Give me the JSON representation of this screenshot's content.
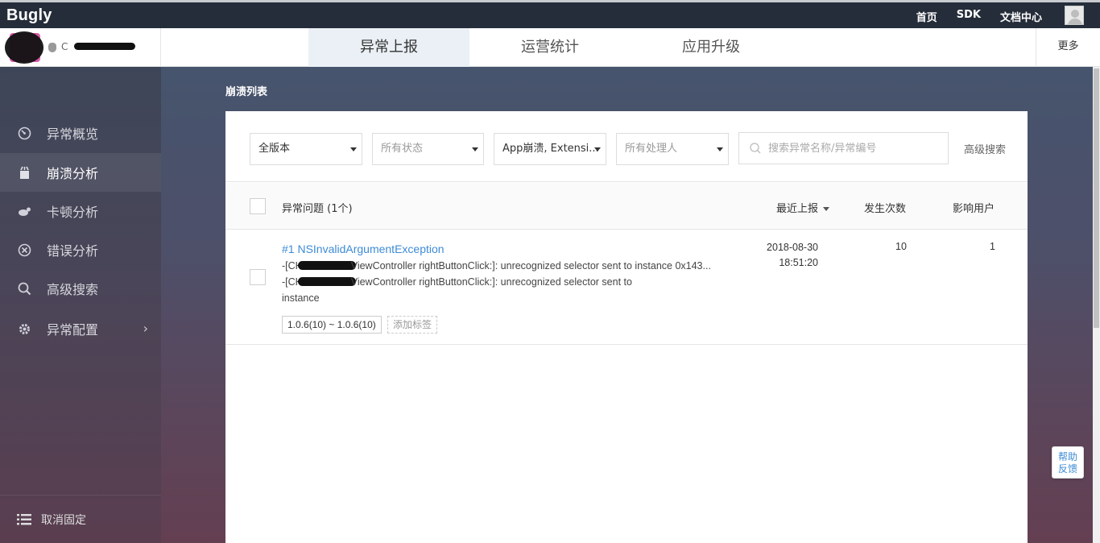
{
  "topbar": {
    "logo": "Bugly",
    "links": [
      "首页",
      "SDK",
      "文档中心"
    ]
  },
  "navbar": {
    "app_name": "C",
    "tabs": [
      "异常上报",
      "运营统计",
      "应用升级"
    ],
    "active_tab": 0,
    "more": "更多"
  },
  "sidebar": {
    "items": [
      {
        "label": "异常概览",
        "icon": "dashboard-icon"
      },
      {
        "label": "崩溃分析",
        "icon": "crash-icon",
        "active": true
      },
      {
        "label": "卡顿分析",
        "icon": "lag-icon"
      },
      {
        "label": "错误分析",
        "icon": "error-icon"
      },
      {
        "label": "高级搜索",
        "icon": "search-icon"
      },
      {
        "label": "异常配置",
        "icon": "gear-icon"
      }
    ],
    "bottom": "取消固定"
  },
  "main": {
    "breadcrumb": "崩溃列表",
    "filters": {
      "version": "全版本",
      "status": "所有状态",
      "type": "App崩溃, Extensi...",
      "assignee": "所有处理人",
      "search_placeholder": "搜索异常名称/异常编号",
      "advanced": "高级搜索"
    },
    "table": {
      "header_issue": "异常问题 (1个)",
      "header_recent": "最近上报",
      "header_count": "发生次数",
      "header_users": "影响用户"
    },
    "rows": [
      {
        "title": "#1 NSInvalidArgumentException",
        "line1_pre": "-[CH",
        "line1_post": "ViewController rightButtonClick:]: unrecognized selector sent to instance 0x143...",
        "line2_pre": "-[CH",
        "line2_post": "ViewController rightButtonClick:]: unrecognized selector sent to",
        "line3": "instance",
        "version_tag": "1.0.6(10) ~ 1.0.6(10)",
        "add_tag": "添加标签",
        "date": "2018-08-30",
        "time": "18:51:20",
        "count": "10",
        "users": "1"
      }
    ]
  },
  "help": {
    "line1": "帮助",
    "line2": "反馈"
  }
}
